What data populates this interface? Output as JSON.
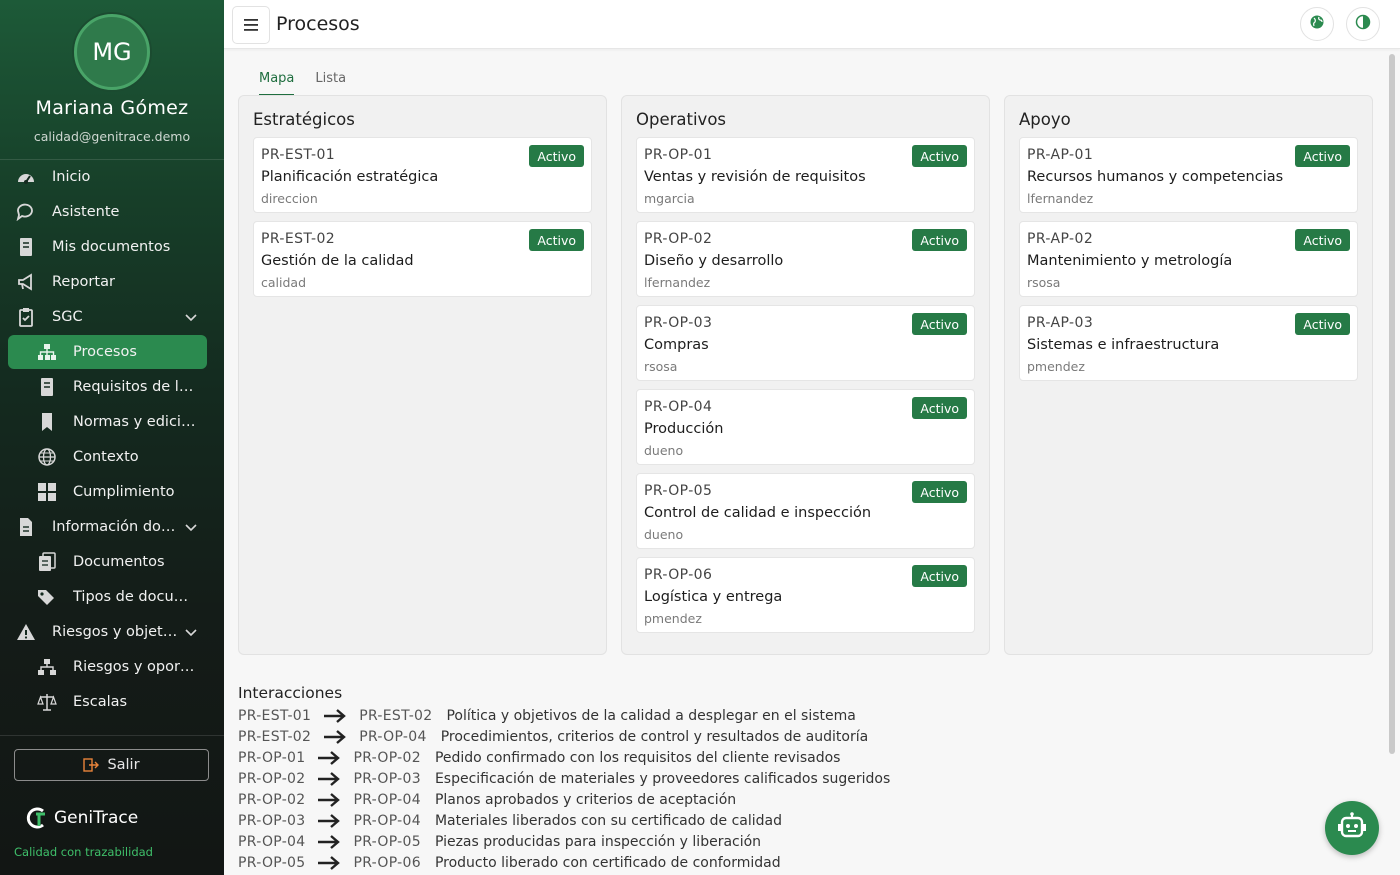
{
  "user": {
    "initials": "MG",
    "name": "Mariana Gómez",
    "email": "calidad@genitrace.demo"
  },
  "nav": [
    {
      "label": "Inicio",
      "icon": "dashboard-icon"
    },
    {
      "label": "Asistente",
      "icon": "chat-icon"
    },
    {
      "label": "Mis documentos",
      "icon": "document-icon"
    },
    {
      "label": "Reportar",
      "icon": "megaphone-icon"
    },
    {
      "label": "SGC",
      "icon": "clipboard-check-icon"
    },
    {
      "label": "Procesos",
      "icon": "sitemap-icon"
    },
    {
      "label": "Requisitos de la n...",
      "icon": "document-icon"
    },
    {
      "label": "Normas y edicion...",
      "icon": "bookmark-icon"
    },
    {
      "label": "Contexto",
      "icon": "globe-icon"
    },
    {
      "label": "Cumplimiento",
      "icon": "grid-icon"
    },
    {
      "label": "Información doc...",
      "icon": "file-icon"
    },
    {
      "label": "Documentos",
      "icon": "documents-icon"
    },
    {
      "label": "Tipos de docume...",
      "icon": "tags-icon"
    },
    {
      "label": "Riesgos y objeti...",
      "icon": "warning-icon"
    },
    {
      "label": "Riesgos y oportu...",
      "icon": "hierarchy-icon"
    },
    {
      "label": "Escalas",
      "icon": "scale-icon"
    }
  ],
  "logout_label": "Salir",
  "brand": {
    "name": "GeniTrace",
    "tagline": "Calidad con trazabilidad"
  },
  "header": {
    "title": "Procesos"
  },
  "tabs": [
    "Mapa",
    "Lista"
  ],
  "columns": [
    {
      "title": "Estratégicos",
      "cards": [
        {
          "code": "PR-EST-01",
          "name": "Planificación estratégica",
          "owner": "direccion",
          "status": "Activo"
        },
        {
          "code": "PR-EST-02",
          "name": "Gestión de la calidad",
          "owner": "calidad",
          "status": "Activo"
        }
      ]
    },
    {
      "title": "Operativos",
      "cards": [
        {
          "code": "PR-OP-01",
          "name": "Ventas y revisión de requisitos",
          "owner": "mgarcia",
          "status": "Activo"
        },
        {
          "code": "PR-OP-02",
          "name": "Diseño y desarrollo",
          "owner": "lfernandez",
          "status": "Activo"
        },
        {
          "code": "PR-OP-03",
          "name": "Compras",
          "owner": "rsosa",
          "status": "Activo"
        },
        {
          "code": "PR-OP-04",
          "name": "Producción",
          "owner": "dueno",
          "status": "Activo"
        },
        {
          "code": "PR-OP-05",
          "name": "Control de calidad e inspección",
          "owner": "dueno",
          "status": "Activo"
        },
        {
          "code": "PR-OP-06",
          "name": "Logística y entrega",
          "owner": "pmendez",
          "status": "Activo"
        }
      ]
    },
    {
      "title": "Apoyo",
      "cards": [
        {
          "code": "PR-AP-01",
          "name": "Recursos humanos y competencias",
          "owner": "lfernandez",
          "status": "Activo"
        },
        {
          "code": "PR-AP-02",
          "name": "Mantenimiento y metrología",
          "owner": "rsosa",
          "status": "Activo"
        },
        {
          "code": "PR-AP-03",
          "name": "Sistemas e infraestructura",
          "owner": "pmendez",
          "status": "Activo"
        }
      ]
    }
  ],
  "interactions_title": "Interacciones",
  "interactions": [
    {
      "from": "PR-EST-01",
      "to": "PR-EST-02",
      "desc": "Política y objetivos de la calidad a desplegar en el sistema"
    },
    {
      "from": "PR-EST-02",
      "to": "PR-OP-04",
      "desc": "Procedimientos, criterios de control y resultados de auditoría"
    },
    {
      "from": "PR-OP-01",
      "to": "PR-OP-02",
      "desc": "Pedido confirmado con los requisitos del cliente revisados"
    },
    {
      "from": "PR-OP-02",
      "to": "PR-OP-03",
      "desc": "Especificación de materiales y proveedores calificados sugeridos"
    },
    {
      "from": "PR-OP-02",
      "to": "PR-OP-04",
      "desc": "Planos aprobados y criterios de aceptación"
    },
    {
      "from": "PR-OP-03",
      "to": "PR-OP-04",
      "desc": "Materiales liberados con su certificado de calidad"
    },
    {
      "from": "PR-OP-04",
      "to": "PR-OP-05",
      "desc": "Piezas producidas para inspección y liberación"
    },
    {
      "from": "PR-OP-05",
      "to": "PR-OP-06",
      "desc": "Producto liberado con certificado de conformidad"
    }
  ],
  "colors": {
    "accent": "#2b8a4f",
    "badge": "#267a46",
    "sidebar": "#142a1f"
  }
}
